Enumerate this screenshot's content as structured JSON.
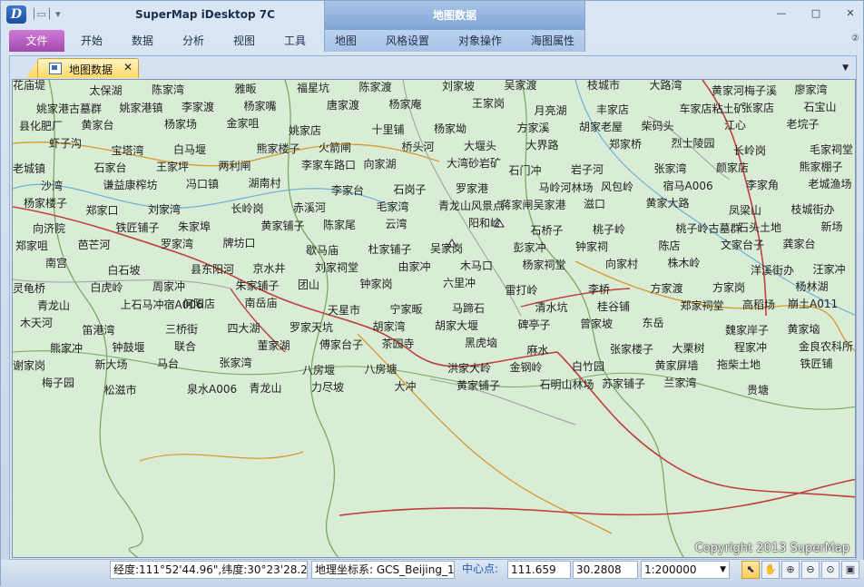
{
  "window": {
    "app_title": "SuperMap iDesktop 7C",
    "context_title": "地图数据",
    "controls": {
      "minimize": "—",
      "restore": "□",
      "close": "✕"
    },
    "help": "②"
  },
  "tabs": [
    {
      "label": "文件"
    },
    {
      "label": "开始"
    },
    {
      "label": "数据"
    },
    {
      "label": "分析"
    },
    {
      "label": "视图"
    },
    {
      "label": "工具"
    },
    {
      "label": "地图"
    },
    {
      "label": "风格设置"
    },
    {
      "label": "对象操作"
    },
    {
      "label": "海图属性"
    }
  ],
  "document_tab": {
    "label": "地图数据",
    "close": "✕"
  },
  "map": {
    "copyright": "Copyright 2013 SuperMap",
    "places": [
      "花庙堤",
      "太保湖",
      "陈家湾",
      "雅畈",
      "福星坑",
      "陈家渡",
      "刘家坡",
      "吴家渡",
      "枝城市",
      "大路湾",
      "黄家河梅子溪",
      "廖家湾",
      "姚家港古墓群",
      "姚家港镇",
      "李家渡",
      "杨家嘴",
      "唐家渡",
      "杨家庵",
      "王家岗",
      "月亮湖",
      "丰家店",
      "车家店粘土矿",
      "张家店",
      "石宝山",
      "县化肥厂",
      "黄家台",
      "杨家场",
      "金家咀",
      "姚家店",
      "十里铺",
      "杨家坳",
      "方家溪",
      "胡家老屋",
      "柴码头",
      "江心",
      "老垸子",
      "虾子沟",
      "宝塔湾",
      "白马堰",
      "熊家楼子",
      "火箭闸",
      "桥头河",
      "大堰头",
      "大界路",
      "郑家桥",
      "烈士陵园",
      "长岭岗",
      "毛家祠堂",
      "老城镇",
      "石家台",
      "王家坪",
      "两利闸",
      "李家车路口",
      "向家湖",
      "大湾砂岩矿",
      "石门冲",
      "岩子河",
      "张家湾",
      "颜家店",
      "熊家棚子",
      "沙湾",
      "谦益康榨坊",
      "冯口镇",
      "湖南村",
      "李家台",
      "石岗子",
      "罗家港",
      "马岭河林场",
      "风包岭",
      "宿马A006",
      "李家角",
      "老城渔场",
      "杨家楼子",
      "郑家口",
      "刘家湾",
      "长岭岗",
      "赤溪河",
      "毛家湾",
      "青龙山风景点",
      "蒋家闸吴家港",
      "滋口",
      "黄家大路",
      "凤梁山",
      "枝城街办",
      "向济院",
      "铁匠铺子",
      "朱家埠",
      "黄家铺子",
      "陈家尾",
      "云湾",
      "阳和岭",
      "石桥子",
      "桃子岭",
      "桃子岭古墓群",
      "石头土地",
      "新场",
      "郑家咀",
      "芭芒河",
      "罗家湾",
      "牌坊口",
      "歇马庙",
      "杜家铺子",
      "吴家岗",
      "彭家冲",
      "钟家祠",
      "陈店",
      "文家台子",
      "龚家台",
      "南宫",
      "白石坡",
      "县东阳河",
      "京水井",
      "刘家祠堂",
      "由家冲",
      "木马口",
      "杨家祠堂",
      "向家村",
      "株木岭",
      "洋溪街办",
      "汪家冲",
      "灵龟桥",
      "白虎岭",
      "周家冲",
      "朱家铺子",
      "团山",
      "钟家岗",
      "六里冲",
      "雷打岭",
      "李桥",
      "方家渡",
      "方家岗",
      "杨林湖",
      "青龙山",
      "上石马冲宿A006",
      "何阳店",
      "南岳庙",
      "天星市",
      "宁家畈",
      "马蹄石",
      "清水坑",
      "桂谷铺",
      "郑家祠堂",
      "高稻场",
      "崩土A011",
      "木天河",
      "笛港湾",
      "三桥街",
      "四大湖",
      "罗家天坑",
      "胡家湾",
      "胡家大堰",
      "碑亭子",
      "曾家坡",
      "东岳",
      "魏家岸子",
      "黄家垴",
      "熊家冲",
      "钟鼓堰",
      "联合",
      "董家湖",
      "傅家台子",
      "茶园寺",
      "黑虎垴",
      "麻水",
      "张家楼子",
      "大栗树",
      "程家冲",
      "金良农科所",
      "谢家岗",
      "新大场",
      "马台",
      "张家湾",
      "八房堰",
      "八房塘",
      "洪家大岭",
      "金钢岭",
      "白竹园",
      "黄家屏墙",
      "拖柴土地",
      "铁匠铺",
      "梅子园",
      "松滋市",
      "泉水A006",
      "青龙山",
      "力尽坡",
      "大冲",
      "黄家铺子",
      "石明山林场",
      "苏家铺子",
      "兰家湾",
      "贵塘"
    ]
  },
  "status_bar": {
    "coords_text": "经度:111°52'44.96\",纬度:30°23'28.22\"",
    "crs_text": "地理坐标系: GCS_Beijing_1954",
    "center_label": "中心点:",
    "center_x": "111.659",
    "center_y": "30.2808",
    "scale": "1:200000",
    "tools": [
      "select-icon",
      "pan-icon",
      "zoom-in-icon",
      "zoom-out-icon",
      "zoom-free-icon",
      "full-extent-icon"
    ]
  },
  "colors": {
    "map_bg": "#d9ecd6",
    "road_red": "#c0403d",
    "road_orange": "#d9982b",
    "river": "#6cb0d8",
    "boundary": "#6a9a5a"
  }
}
